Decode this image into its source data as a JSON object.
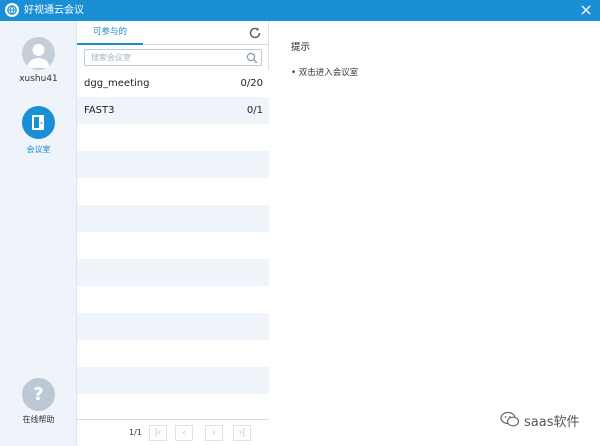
{
  "titlebar": {
    "title": "好视通云会议",
    "app_icon": "globe-icon",
    "close_icon": "close-icon"
  },
  "left_nav": {
    "username": "xushu41",
    "items": [
      {
        "label": "会议室",
        "icon": "meeting-room-icon",
        "active": true
      }
    ],
    "help": {
      "label": "在线帮助",
      "icon": "help-icon",
      "glyph": "?"
    }
  },
  "middle": {
    "tabs": [
      {
        "label": "可参与的",
        "active": true
      }
    ],
    "refresh_icon": "refresh-icon",
    "search": {
      "placeholder": "搜索会议室",
      "value": ""
    },
    "rooms": [
      {
        "name": "dgg_meeting",
        "count": "0/20"
      },
      {
        "name": "FAST3",
        "count": "0/1"
      }
    ],
    "pager": {
      "page": "1/1",
      "first": "|‹",
      "prev": "‹",
      "next": "›",
      "last": "›|"
    }
  },
  "right": {
    "hint_title": "提示",
    "hint_item": "• 双击进入会议室"
  },
  "watermark": {
    "text": "saas软件",
    "icon": "wechat-icon"
  },
  "colors": {
    "accent": "#1a8fd6",
    "nav_bg": "#eef4fa",
    "row_alt": "#eef4fa"
  }
}
